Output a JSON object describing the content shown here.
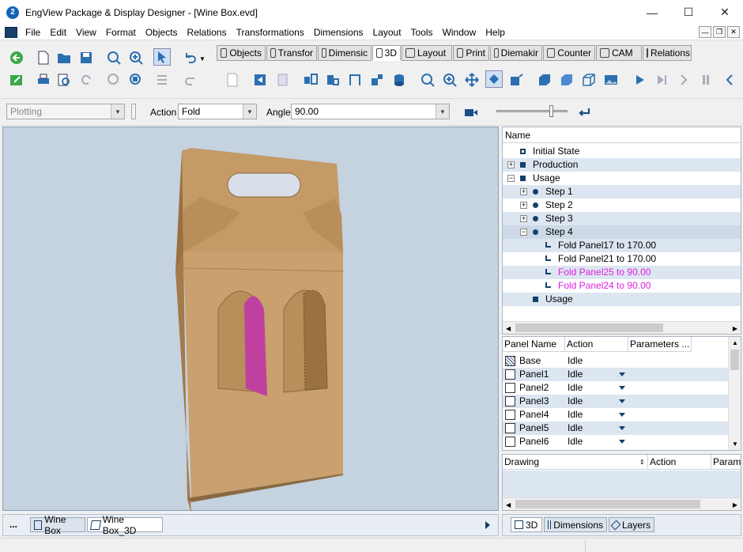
{
  "window": {
    "title": "EngView Package & Display Designer - [Wine Box.evd]",
    "logo": "2"
  },
  "menu": [
    {
      "label": "File",
      "key": "F"
    },
    {
      "label": "Edit",
      "key": "E"
    },
    {
      "label": "View",
      "key": "V"
    },
    {
      "label": "Format",
      "key": "m"
    },
    {
      "label": "Objects",
      "key": "O"
    },
    {
      "label": "Relations",
      "key": "R"
    },
    {
      "label": "Transformations",
      "key": "a"
    },
    {
      "label": "Dimensions",
      "key": "D"
    },
    {
      "label": "Layout",
      "key": "L"
    },
    {
      "label": "Tools",
      "key": "T"
    },
    {
      "label": "Window",
      "key": "W"
    },
    {
      "label": "Help",
      "key": "H"
    }
  ],
  "command_tabs": [
    "Objects",
    "Transfor",
    "Dimensic",
    "3D",
    "Layout",
    "Print",
    "Diemakir",
    "Counter",
    "CAM",
    "Relations"
  ],
  "active_tab": "3D",
  "properties": {
    "mode_value": "Plotting",
    "action_label": "Action",
    "action_value": "Fold",
    "angle_label": "Angle",
    "angle_value": "90.00"
  },
  "tree": {
    "header": "Name",
    "rows": [
      {
        "label": "Initial State",
        "indent": 0,
        "icon": "square-outline",
        "expander": ""
      },
      {
        "label": "Production",
        "indent": 0,
        "icon": "square",
        "expander": "+"
      },
      {
        "label": "Usage",
        "indent": 0,
        "icon": "square",
        "expander": "−"
      },
      {
        "label": "Step 1",
        "indent": 1,
        "icon": "dot",
        "expander": "+"
      },
      {
        "label": "Step 2",
        "indent": 1,
        "icon": "dot",
        "expander": "+"
      },
      {
        "label": "Step 3",
        "indent": 1,
        "icon": "dot",
        "expander": "+"
      },
      {
        "label": "Step 4",
        "indent": 1,
        "icon": "dot",
        "expander": "−"
      },
      {
        "label": "Fold Panel17 to 170.00",
        "indent": 2,
        "icon": "fold",
        "expander": "",
        "color": "#000000"
      },
      {
        "label": "Fold Panel21 to 170.00",
        "indent": 2,
        "icon": "fold",
        "expander": "",
        "color": "#000000"
      },
      {
        "label": "Fold Panel25 to 90.00",
        "indent": 2,
        "icon": "fold",
        "expander": "",
        "color": "#e020e0"
      },
      {
        "label": "Fold Panel24 to 90.00",
        "indent": 2,
        "icon": "fold",
        "expander": "",
        "color": "#e020e0"
      },
      {
        "label": "Usage",
        "indent": 1,
        "icon": "square",
        "expander": ""
      }
    ]
  },
  "panel_grid": {
    "headers": [
      "Panel Name",
      "Action",
      "Parameters ..."
    ],
    "rows": [
      {
        "name": "Base",
        "action": "Idle",
        "dropdown": false
      },
      {
        "name": "Panel1",
        "action": "Idle",
        "dropdown": true
      },
      {
        "name": "Panel2",
        "action": "Idle",
        "dropdown": true
      },
      {
        "name": "Panel3",
        "action": "Idle",
        "dropdown": true
      },
      {
        "name": "Panel4",
        "action": "Idle",
        "dropdown": true
      },
      {
        "name": "Panel5",
        "action": "Idle",
        "dropdown": true
      },
      {
        "name": "Panel6",
        "action": "Idle",
        "dropdown": true
      }
    ]
  },
  "drawing_panel": {
    "headers": [
      "Drawing",
      "Action",
      "Param"
    ]
  },
  "doc_tabs": {
    "more": "...",
    "tabs": [
      "Wine Box",
      "Wine Box_3D"
    ],
    "active": "Wine Box_3D"
  },
  "side_tabs": [
    "3D",
    "Dimensions",
    "Layers"
  ],
  "colors": {
    "cardboard": "#c8a070",
    "window_magenta": "#c040a0",
    "viewport_bg": "#c5d2e0"
  }
}
